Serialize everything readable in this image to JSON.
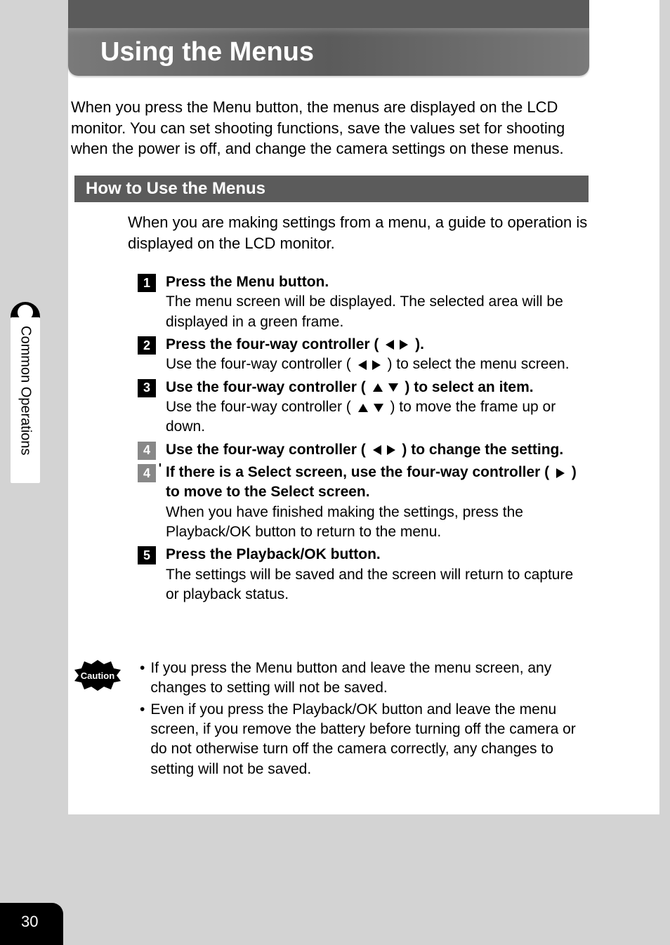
{
  "title": "Using the Menus",
  "intro": "When you press the Menu button, the menus are displayed on the LCD monitor. You can set shooting functions, save the values set for shooting when the power is off, and change the camera settings on these menus.",
  "section_title": "How to Use the Menus",
  "section_intro": "When you are making settings from a menu, a guide to operation is displayed on the LCD monitor.",
  "steps": [
    {
      "num": "1",
      "prime": false,
      "gray": false,
      "title": "Press the Menu button.",
      "arrows": [],
      "desc_pre": "",
      "desc": "The menu screen will be displayed. The selected area will be displayed in a green frame."
    },
    {
      "num": "2",
      "prime": false,
      "gray": false,
      "title_pre": "Press the four-way controller ( ",
      "title_post": " ).",
      "arrows": [
        "left",
        "right"
      ],
      "desc_pre": "Use the four-way controller ( ",
      "desc_arrows": [
        "left",
        "right"
      ],
      "desc_post": " ) to select the menu screen."
    },
    {
      "num": "3",
      "prime": false,
      "gray": false,
      "title_pre": "Use the four-way controller ( ",
      "title_post": " ) to select an item.",
      "arrows": [
        "up",
        "down"
      ],
      "desc_pre": "Use the four-way controller ( ",
      "desc_arrows": [
        "up",
        "down"
      ],
      "desc_post": " ) to move the frame up or down."
    },
    {
      "num": "4",
      "prime": false,
      "gray": true,
      "title_pre": "Use the four-way controller ( ",
      "title_post": " ) to change the setting.",
      "arrows": [
        "left",
        "right"
      ],
      "desc": ""
    },
    {
      "num": "4",
      "prime": true,
      "gray": true,
      "title_pre": "If there is a Select screen, use the four-way controller ( ",
      "title_post": " ) to move to the Select screen.",
      "arrows": [
        "right"
      ],
      "desc": "When you have finished making the settings, press the Playback/OK button to return to the menu."
    },
    {
      "num": "5",
      "prime": false,
      "gray": false,
      "title": "Press the Playback/OK button.",
      "arrows": [],
      "desc": "The settings will be saved and the screen will return to capture or playback status."
    }
  ],
  "caution_label": "Caution",
  "caution_items": [
    "If you press the Menu button and leave the menu screen, any changes to setting will not be saved.",
    "Even if you press the Playback/OK button and leave the menu screen, if you remove the battery before turning off the camera or do not otherwise turn off the camera correctly, any changes to setting will not be saved."
  ],
  "side_tab": "Common Operations",
  "page_number": "30"
}
